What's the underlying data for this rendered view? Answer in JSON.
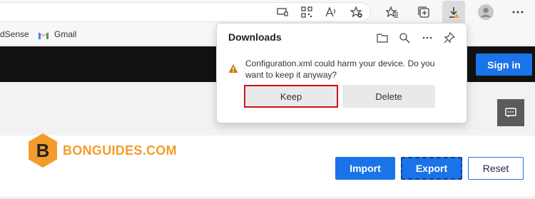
{
  "bookmarks": {
    "items": [
      {
        "label": "dSense"
      },
      {
        "label": "Gmail"
      }
    ]
  },
  "toolbar": {
    "icons": [
      "screen-cast-icon",
      "qr-code-icon",
      "read-aloud-icon",
      "add-favorite-icon",
      "favorites-icon",
      "collections-icon",
      "downloads-icon",
      "profile-icon",
      "more-icon"
    ]
  },
  "downloads": {
    "title": "Downloads",
    "warning_message": "Configuration.xml could harm your device. Do you want to keep it anyway?",
    "keep_label": "Keep",
    "delete_label": "Delete"
  },
  "site": {
    "signin_label": "Sign in",
    "logo_text": "BONGUIDES.COM",
    "logo_letter": "B",
    "actions": {
      "import_label": "Import",
      "export_label": "Export",
      "reset_label": "Reset"
    }
  },
  "colors": {
    "accent": "#1a73e8",
    "logo": "#f39c2c",
    "highlight_border": "#d0101b",
    "warning": "#c87d0a"
  }
}
